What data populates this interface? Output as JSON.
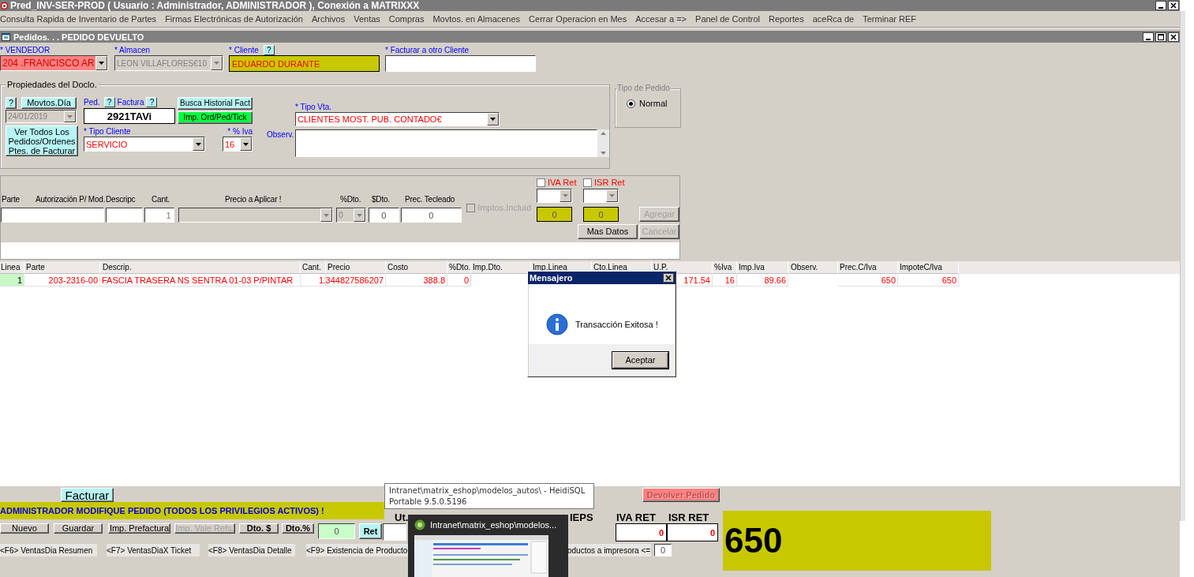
{
  "title_bar": {
    "title": "Pred_INV-SER-PROD ( Usuario : Administrador, ADMINISTRADOR   ), Conexión a MATRIXXX"
  },
  "menu": [
    "Consulta Rapida de Inventario de Partes",
    "Firmas Electrónicas de Autorización",
    "Archivos",
    "Ventas",
    "Compras",
    "Movtos. en Almacenes",
    "Cerrar Operacion en Mes",
    "Accesar a =>",
    "Panel de Control",
    "Reportes",
    "aceRca de",
    "Terminar REF"
  ],
  "child_window": {
    "title": "Pedidos. . . PEDIDO DEVUELTO"
  },
  "header": {
    "vendedor": {
      "label": "* VENDEDOR",
      "value": "204 .FRANCISCO AR"
    },
    "almacen": {
      "label": "* Almacen",
      "value": "LEON VILLAFLORES€10",
      "disabled": true
    },
    "cliente": {
      "label": "* Cliente",
      "help": "?",
      "value": "EDUARDO DURANTE"
    },
    "facturar_otro": {
      "label": "* Facturar a otro Cliente"
    }
  },
  "propiedades": {
    "legend": "Propiedades del Doclo.",
    "help": "?",
    "movtos_button": "Movtos.Día",
    "fecha": {
      "value": "24/01/2019",
      "disabled": true
    },
    "ver_todos_button": "Ver Todos Los Pedidos/Ordenes Ptes. de Facturar",
    "ped_label": "Ped.",
    "ped_help": "?",
    "factura_label": "Factura",
    "factura_help": "?",
    "folio": "2921TAVi",
    "busca_button": "Busca Historial Fact",
    "imp_button": "Imp. Ord/Ped/Tick",
    "tipo_cliente": {
      "label": "* Tipo Cliente",
      "value": "SERVICIO"
    },
    "iva": {
      "label": "* % Iva",
      "value": "16"
    },
    "tipo_vta": {
      "label": "* Tipo Vta.",
      "value": "CLIENTES MOST. PUB. CONTADO€"
    },
    "observ_label": "Observ."
  },
  "tipo_pedido": {
    "legend": "Tipo de Pedido",
    "options": [
      {
        "label": "Normal",
        "selected": true
      }
    ]
  },
  "entrada": {
    "labels": [
      "Parte",
      "Autorización P/ Mod.",
      "Descripc",
      "Cant.",
      "Precio a Aplicar !",
      "%Dto.",
      "$Dto.",
      "Prec. Tecleado"
    ],
    "cant": "1",
    "dto_pct": "0",
    "dto_amt": "0",
    "prec_tecleado": "0",
    "imptos": {
      "label": "Imptos.Incluid",
      "checked": false,
      "disabled": true
    },
    "iva_ret": {
      "label": "IVA Ret",
      "checked": false,
      "value": "0"
    },
    "isr_ret": {
      "label": "ISR Ret",
      "checked": false,
      "value": "0"
    },
    "buttons": [
      {
        "label": "Agregar",
        "disabled": true
      },
      {
        "label": "Mas Datos",
        "disabled": false
      },
      {
        "label": "Cancelar",
        "disabled": true
      }
    ]
  },
  "grid": {
    "columns": [
      {
        "label": "Linea",
        "kind": "index"
      },
      {
        "label": "Parte",
        "kind": "number"
      },
      {
        "label": "Descrip.",
        "kind": "text"
      },
      {
        "label": "Cant.",
        "kind": "number"
      },
      {
        "label": "Precio",
        "kind": "number"
      },
      {
        "label": "Costo",
        "kind": "number"
      },
      {
        "label": "%Dto.",
        "kind": "number"
      },
      {
        "label": "Imp.Dto.",
        "kind": "number"
      },
      {
        "label": "Imp.Linea",
        "kind": "number"
      },
      {
        "label": "Cto.Linea",
        "kind": "number"
      },
      {
        "label": "U.P.",
        "kind": "number"
      },
      {
        "label": "%Iva",
        "kind": "number"
      },
      {
        "label": "Imp.Iva",
        "kind": "number"
      },
      {
        "label": "Observ.",
        "kind": "text"
      },
      {
        "label": "Prec.C/Iva",
        "kind": "number"
      },
      {
        "label": "ImpoteC/Iva",
        "kind": "number"
      }
    ],
    "rows": [
      {
        "cells": [
          "1",
          "203-2316-00",
          "FASCIA TRASERA NS SENTRA 01-03 P/PINTAR",
          "1",
          ".344827586207",
          "388.8",
          "0",
          null,
          null,
          null,
          "171.54",
          "16",
          "89.66",
          null,
          "650",
          "650"
        ]
      }
    ]
  },
  "dialog": {
    "title": "Mensajero",
    "message": "Transacción Exitosa !",
    "button": "Aceptar"
  },
  "bottom": {
    "facturar_button": "Facturar",
    "devolver_button": {
      "label": "Devolver Pedido",
      "disabled": true
    },
    "banner": "ADMINISTRADOR MODIFIQUE PEDIDO (TODOS LOS PRIVILEGIOS ACTIVOS) !",
    "buttons": [
      {
        "label": "Nuevo",
        "disabled": false,
        "bold": false
      },
      {
        "label": "Guardar",
        "disabled": false,
        "bold": false
      },
      {
        "label": "Imp. Prefactura",
        "disabled": false,
        "bold": false
      },
      {
        "label": "Imp. Vale Refs.",
        "disabled": true,
        "bold": false
      },
      {
        "label": "Dto. $",
        "disabled": false,
        "bold": true
      },
      {
        "label": "Dto.%",
        "disabled": false,
        "bold": true
      }
    ],
    "dto_value": "0",
    "ret_button": "Ret",
    "totals_labels": [
      "Ut.",
      "IEPS",
      "IVA RET",
      "ISR RET"
    ],
    "iva_ret": "0",
    "isr_ret": "0",
    "total": "650",
    "shortcuts": [
      "<F6> VentasDia Resumen",
      "<F7> VentasDiaX Ticket",
      "<F8> VentasDia Detalle",
      "<F9> Existencia de Producto"
    ],
    "impresora_label": "oductos a impresora <=",
    "impresora_value": "0"
  },
  "tooltip": {
    "lines": [
      "Intranet\\matrix_eshop\\modelos_autos\\ - HeidiSQL",
      "Portable 9.5.0.5196"
    ]
  },
  "taskbar_preview": {
    "title": "Intranet\\matrix_eshop\\modelos..."
  }
}
